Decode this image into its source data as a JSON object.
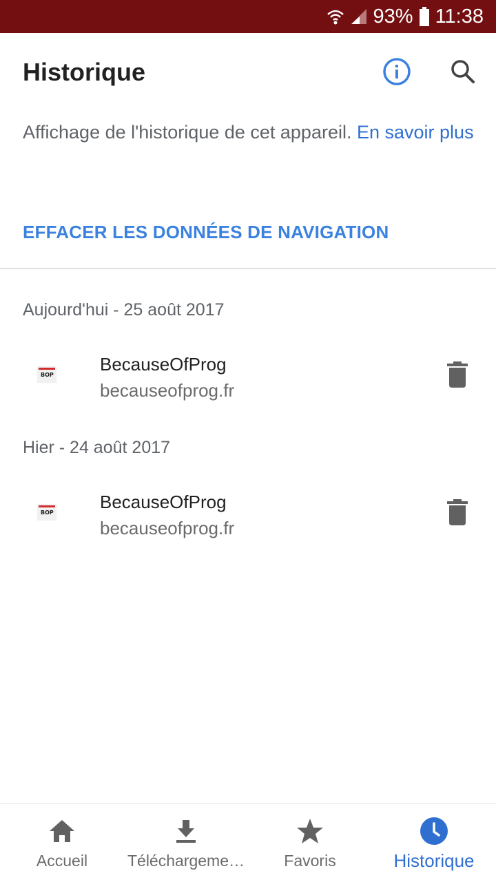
{
  "status_bar": {
    "battery": "93%",
    "time": "11:38",
    "background": "#730f10"
  },
  "header": {
    "title": "Historique",
    "info_icon": "info-icon",
    "search_icon": "search-icon"
  },
  "intro": {
    "text": "Affichage de l'historique de cet appareil. ",
    "link": "En savoir plus"
  },
  "clear_button": "EFFACER LES DONNÉES DE NAVIGATION",
  "sections": [
    {
      "date": "Aujourd'hui - 25 août 2017",
      "items": [
        {
          "title": "BecauseOfProg",
          "url": "becauseofprog.fr",
          "favicon": "BOP"
        }
      ]
    },
    {
      "date": "Hier - 24 août 2017",
      "items": [
        {
          "title": "BecauseOfProg",
          "url": "becauseofprog.fr",
          "favicon": "BOP"
        }
      ]
    }
  ],
  "bottom_nav": [
    {
      "label": "Accueil",
      "icon": "home-icon",
      "active": false
    },
    {
      "label": "Téléchargeme…",
      "icon": "download-icon",
      "active": false
    },
    {
      "label": "Favoris",
      "icon": "star-icon",
      "active": false
    },
    {
      "label": "Historique",
      "icon": "history-clock-icon",
      "active": true
    }
  ],
  "colors": {
    "accent": "#3b82e0",
    "link": "#2f6fd0",
    "icon_grey": "#616161"
  }
}
